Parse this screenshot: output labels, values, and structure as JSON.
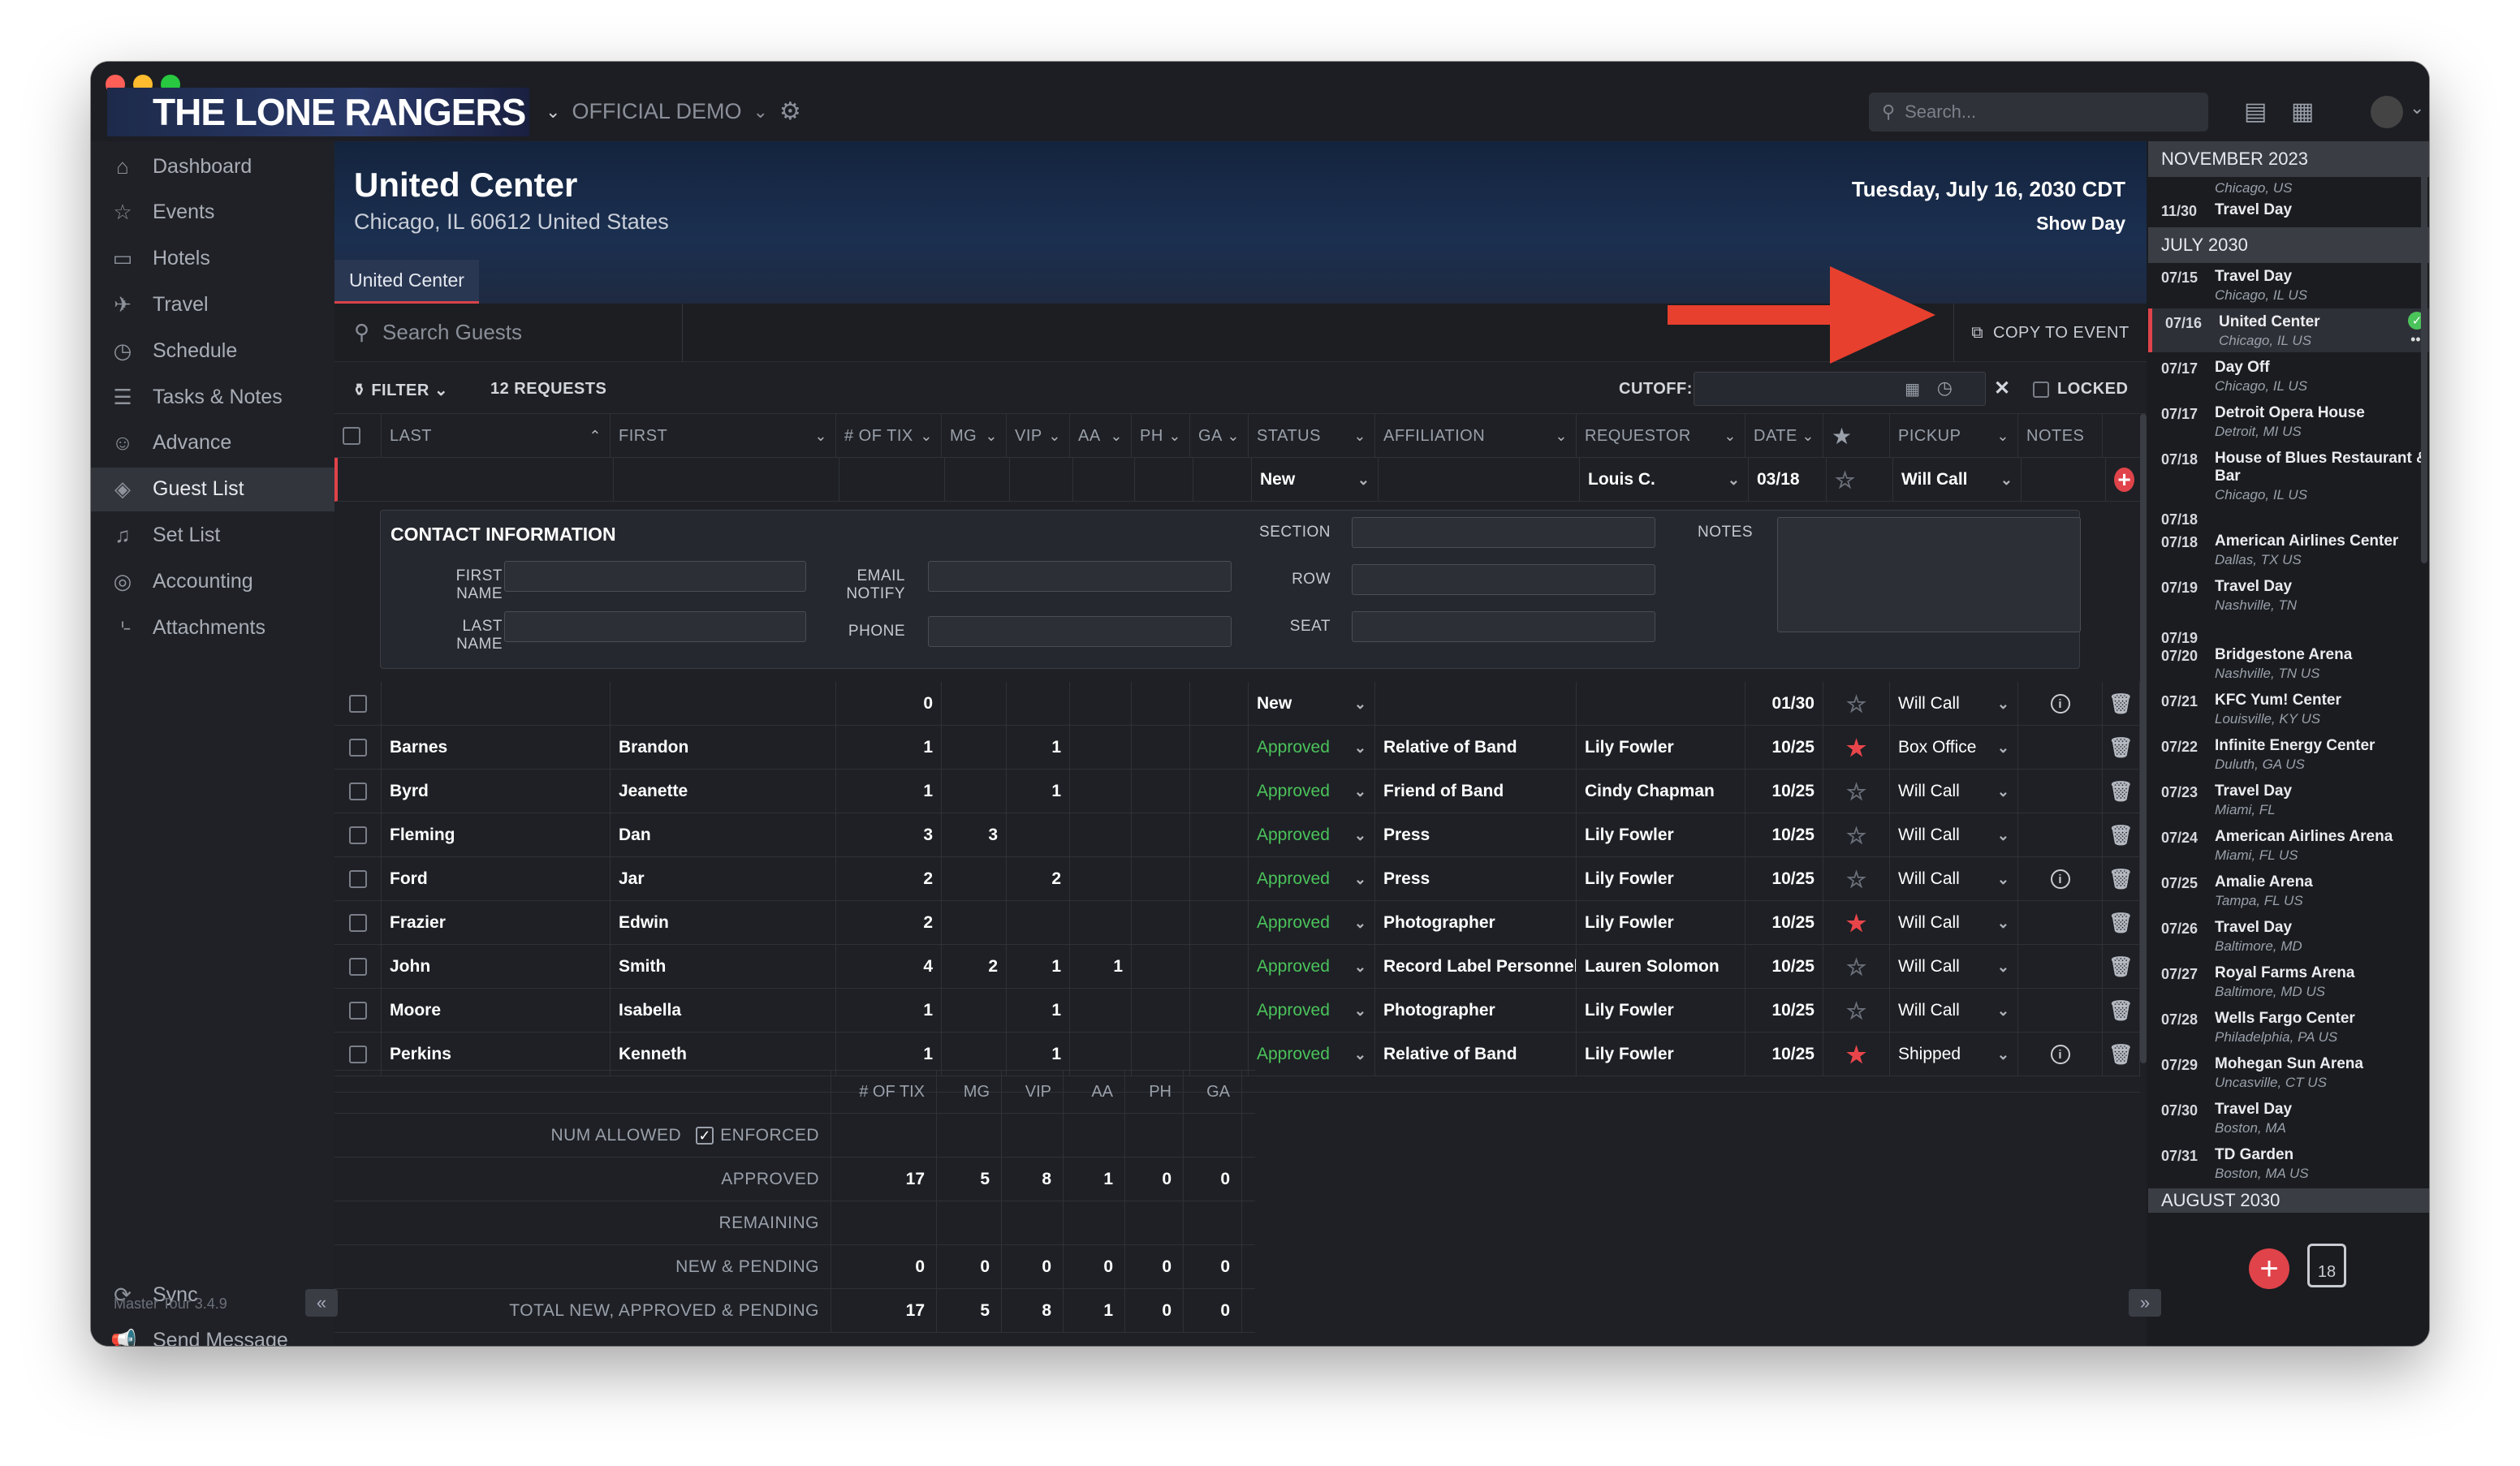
{
  "app": {
    "logo_text": "THE LONE RANGERS",
    "project": "OFFICIAL DEMO",
    "search_placeholder": "Search...",
    "version": "Master Tour 3.4.9"
  },
  "sidebar": {
    "items": [
      {
        "label": "Dashboard",
        "icon": "home-icon"
      },
      {
        "label": "Events",
        "icon": "star-icon"
      },
      {
        "label": "Hotels",
        "icon": "hotel-icon"
      },
      {
        "label": "Travel",
        "icon": "plane-icon"
      },
      {
        "label": "Schedule",
        "icon": "clock-icon"
      },
      {
        "label": "Tasks & Notes",
        "icon": "list-icon"
      },
      {
        "label": "Advance",
        "icon": "user-icon"
      },
      {
        "label": "Guest List",
        "icon": "ticket-icon"
      },
      {
        "label": "Set List",
        "icon": "music-icon"
      },
      {
        "label": "Accounting",
        "icon": "coins-icon"
      },
      {
        "label": "Attachments",
        "icon": "paperclip-icon"
      }
    ],
    "sync": "Sync",
    "send_message": "Send Message"
  },
  "header": {
    "venue": "United Center",
    "address": "Chicago, IL 60612 United States",
    "date": "Tuesday, July 16, 2030 CDT",
    "day_type": "Show Day",
    "tab": "United Center"
  },
  "toolbar": {
    "search_placeholder": "Search Guests",
    "copy_to_event": "COPY TO EVENT"
  },
  "filterbar": {
    "filter": "FILTER",
    "requests": "12 REQUESTS",
    "cutoff": "CUTOFF:",
    "locked": "LOCKED"
  },
  "columns": [
    "LAST",
    "FIRST",
    "# OF TIX",
    "MG",
    "VIP",
    "AA",
    "PH",
    "GA",
    "STATUS",
    "AFFILIATION",
    "REQUESTOR",
    "DATE",
    "PICKUP",
    "NOTES"
  ],
  "new_row": {
    "status": "New",
    "requestor": "Louis C.",
    "date": "03/18",
    "pickup": "Will Call"
  },
  "contact": {
    "title": "CONTACT INFORMATION",
    "first_name": "FIRST NAME",
    "last_name": "LAST NAME",
    "email_notify": "EMAIL NOTIFY",
    "phone": "PHONE",
    "section": "SECTION",
    "row": "ROW",
    "seat": "SEAT",
    "notes": "NOTES"
  },
  "rows": [
    {
      "last": "",
      "first": "",
      "tix": "0",
      "mg": "",
      "vip": "",
      "aa": "",
      "ph": "",
      "ga": "",
      "status": "New",
      "affiliation": "",
      "requestor": "",
      "date": "01/30",
      "starred": false,
      "pickup": "Will Call",
      "note": true
    },
    {
      "last": "Barnes",
      "first": "Brandon",
      "tix": "1",
      "mg": "",
      "vip": "1",
      "aa": "",
      "ph": "",
      "ga": "",
      "status": "Approved",
      "affiliation": "Relative of Band",
      "requestor": "Lily Fowler",
      "date": "10/25",
      "starred": true,
      "pickup": "Box Office",
      "note": false
    },
    {
      "last": "Byrd",
      "first": "Jeanette",
      "tix": "1",
      "mg": "",
      "vip": "1",
      "aa": "",
      "ph": "",
      "ga": "",
      "status": "Approved",
      "affiliation": "Friend of Band",
      "requestor": "Cindy Chapman",
      "date": "10/25",
      "starred": false,
      "pickup": "Will Call",
      "note": false
    },
    {
      "last": "Fleming",
      "first": "Dan",
      "tix": "3",
      "mg": "3",
      "vip": "",
      "aa": "",
      "ph": "",
      "ga": "",
      "status": "Approved",
      "affiliation": "Press",
      "requestor": "Lily Fowler",
      "date": "10/25",
      "starred": false,
      "pickup": "Will Call",
      "note": false
    },
    {
      "last": "Ford",
      "first": "Jar",
      "tix": "2",
      "mg": "",
      "vip": "2",
      "aa": "",
      "ph": "",
      "ga": "",
      "status": "Approved",
      "affiliation": "Press",
      "requestor": "Lily Fowler",
      "date": "10/25",
      "starred": false,
      "pickup": "Will Call",
      "note": true
    },
    {
      "last": "Frazier",
      "first": "Edwin",
      "tix": "2",
      "mg": "",
      "vip": "",
      "aa": "",
      "ph": "",
      "ga": "",
      "status": "Approved",
      "affiliation": "Photographer",
      "requestor": "Lily Fowler",
      "date": "10/25",
      "starred": true,
      "pickup": "Will Call",
      "note": false
    },
    {
      "last": "John",
      "first": "Smith",
      "tix": "4",
      "mg": "2",
      "vip": "1",
      "aa": "1",
      "ph": "",
      "ga": "",
      "status": "Approved",
      "affiliation": "Record Label Personnel",
      "requestor": "Lauren Solomon",
      "date": "10/25",
      "starred": false,
      "pickup": "Will Call",
      "note": false
    },
    {
      "last": "Moore",
      "first": "Isabella",
      "tix": "1",
      "mg": "",
      "vip": "1",
      "aa": "",
      "ph": "",
      "ga": "",
      "status": "Approved",
      "affiliation": "Photographer",
      "requestor": "Lily Fowler",
      "date": "10/25",
      "starred": false,
      "pickup": "Will Call",
      "note": false
    },
    {
      "last": "Perkins",
      "first": "Kenneth",
      "tix": "1",
      "mg": "",
      "vip": "1",
      "aa": "",
      "ph": "",
      "ga": "",
      "status": "Approved",
      "affiliation": "Relative of Band",
      "requestor": "Lily Fowler",
      "date": "10/25",
      "starred": true,
      "pickup": "Shipped",
      "note": true
    }
  ],
  "totals": {
    "headers": [
      "# OF TIX",
      "MG",
      "VIP",
      "AA",
      "PH",
      "GA"
    ],
    "num_allowed": "NUM ALLOWED",
    "enforced": "ENFORCED",
    "rows": [
      {
        "label": "APPROVED",
        "values": [
          "17",
          "5",
          "8",
          "1",
          "0",
          "0"
        ]
      },
      {
        "label": "REMAINING",
        "values": [
          "",
          "",
          "",
          "",
          "",
          ""
        ]
      },
      {
        "label": "NEW & PENDING",
        "values": [
          "0",
          "0",
          "0",
          "0",
          "0",
          "0"
        ]
      },
      {
        "label": "TOTAL NEW, APPROVED & PENDING",
        "values": [
          "17",
          "5",
          "8",
          "1",
          "0",
          "0"
        ]
      }
    ]
  },
  "schedule": {
    "month1": "NOVEMBER 2023",
    "top_loc": "Chicago, US",
    "top_item": {
      "date": "11/30",
      "name": "Travel Day"
    },
    "month2": "JULY 2030",
    "items": [
      {
        "date": "07/15",
        "name": "Travel Day",
        "loc": "Chicago, IL US"
      },
      {
        "date": "07/16",
        "name": "United Center",
        "loc": "Chicago, IL US"
      },
      {
        "date": "07/17",
        "name": "Day Off",
        "loc": "Chicago, IL US"
      },
      {
        "date": "07/17",
        "name": "Detroit Opera House",
        "loc": "Detroit, MI US"
      },
      {
        "date": "07/18",
        "name": "House of Blues Restaurant & Bar",
        "loc": "Chicago, IL US"
      },
      {
        "date": "07/18",
        "name": "",
        "loc": ""
      },
      {
        "date": "07/18",
        "name": "American Airlines Center",
        "loc": "Dallas, TX US"
      },
      {
        "date": "07/19",
        "name": "Travel Day",
        "loc": "Nashville, TN"
      },
      {
        "date": "07/19",
        "name": "",
        "loc": ""
      },
      {
        "date": "07/20",
        "name": "Bridgestone Arena",
        "loc": "Nashville, TN US"
      },
      {
        "date": "07/21",
        "name": "KFC Yum! Center",
        "loc": "Louisville, KY US"
      },
      {
        "date": "07/22",
        "name": "Infinite Energy Center",
        "loc": "Duluth, GA US"
      },
      {
        "date": "07/23",
        "name": "Travel Day",
        "loc": "Miami, FL"
      },
      {
        "date": "07/24",
        "name": "American Airlines Arena",
        "loc": "Miami, FL US"
      },
      {
        "date": "07/25",
        "name": "Amalie Arena",
        "loc": "Tampa, FL US"
      },
      {
        "date": "07/26",
        "name": "Travel Day",
        "loc": "Baltimore, MD"
      },
      {
        "date": "07/27",
        "name": "Royal Farms Arena",
        "loc": "Baltimore, MD US"
      },
      {
        "date": "07/28",
        "name": "Wells Fargo Center",
        "loc": "Philadelphia, PA US"
      },
      {
        "date": "07/29",
        "name": "Mohegan Sun Arena",
        "loc": "Uncasville, CT US"
      },
      {
        "date": "07/30",
        "name": "Travel Day",
        "loc": "Boston, MA"
      },
      {
        "date": "07/31",
        "name": "TD Garden",
        "loc": "Boston, MA US"
      }
    ],
    "month3": "AUGUST 2030",
    "calendar_day": "18"
  },
  "colors": {
    "accent": "#e0434a",
    "approved": "#4bc35b",
    "arrow": "#e8402e"
  }
}
